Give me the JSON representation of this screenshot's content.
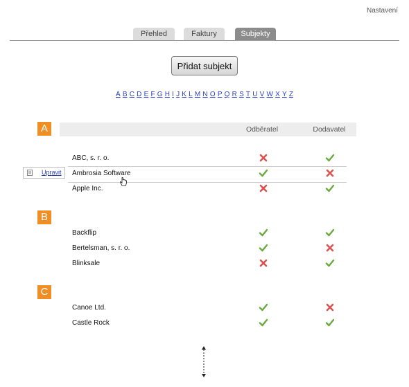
{
  "header": {
    "settings_label": "Nastavení"
  },
  "tabs": [
    {
      "label": "Přehled",
      "active": false
    },
    {
      "label": "Faktury",
      "active": false
    },
    {
      "label": "Subjekty",
      "active": true
    }
  ],
  "add_button_label": "Přidat subjekt",
  "alphabet": [
    "A",
    "B",
    "C",
    "D",
    "E",
    "F",
    "G",
    "H",
    "I",
    "J",
    "K",
    "L",
    "M",
    "N",
    "O",
    "P",
    "Q",
    "R",
    "S",
    "T",
    "U",
    "V",
    "W",
    "X",
    "Y",
    "Z"
  ],
  "columns": {
    "customer": "Odběratel",
    "supplier": "Dodavatel"
  },
  "colors": {
    "accent": "#ee8e24",
    "check": "#6aaa3c",
    "cross": "#d9534f",
    "link": "#2a3fbf"
  },
  "sections": [
    {
      "letter": "A",
      "rows": [
        {
          "name": "ABC, s. r. o.",
          "customer": false,
          "supplier": true
        },
        {
          "name": "Ambrosia Software",
          "customer": true,
          "supplier": false,
          "hover": true
        },
        {
          "name": "Apple Inc.",
          "customer": false,
          "supplier": true
        }
      ]
    },
    {
      "letter": "B",
      "rows": [
        {
          "name": "Backflip",
          "customer": true,
          "supplier": true
        },
        {
          "name": "Bertelsman, s. r. o.",
          "customer": true,
          "supplier": false
        },
        {
          "name": "Blinksale",
          "customer": false,
          "supplier": true
        }
      ]
    },
    {
      "letter": "C",
      "rows": [
        {
          "name": "Canoe Ltd.",
          "customer": true,
          "supplier": false
        },
        {
          "name": "Castle Rock",
          "customer": true,
          "supplier": true
        }
      ]
    }
  ],
  "row_action": {
    "label": "Upravit",
    "icon": "document-icon"
  }
}
